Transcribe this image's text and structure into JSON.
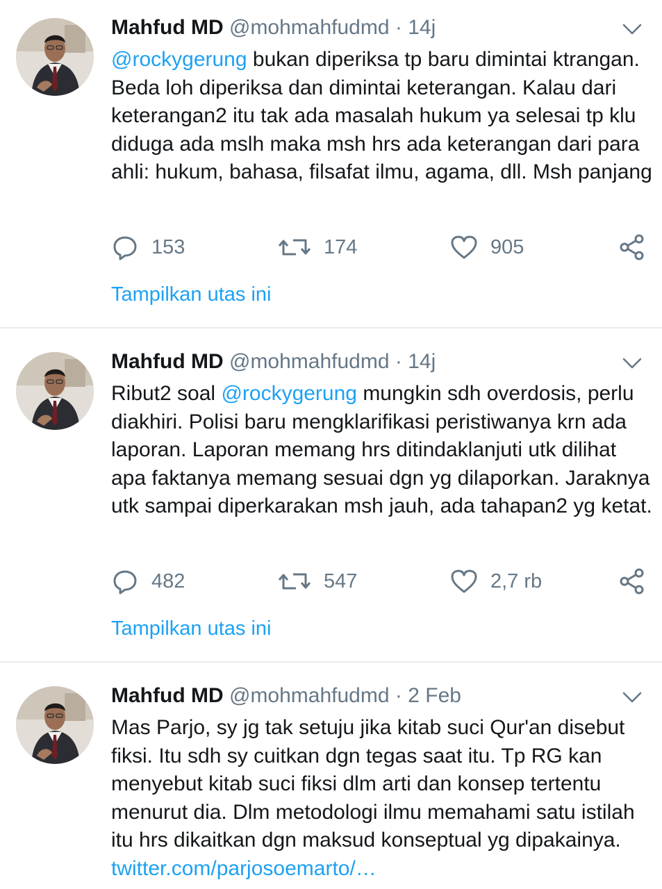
{
  "tweets": [
    {
      "author_name": "Mahfud MD",
      "handle": "@mohmahfudmd",
      "separator": "·",
      "time": "14j",
      "mention": "@rockygerung",
      "text_after_mention": " bukan diperiksa tp baru dimintai ktrangan. Beda loh diperiksa dan dimintai keterangan. Kalau dari keterangan2 itu tak ada masalah hukum ya selesai tp klu diduga ada mslh maka msh hrs ada keterangan dari para ahli: hukum, bahasa, filsafat ilmu, agama, dll. Msh panjang",
      "replies": "153",
      "retweets": "174",
      "likes": "905",
      "thread_link": "Tampilkan utas ini"
    },
    {
      "author_name": "Mahfud MD",
      "handle": "@mohmahfudmd",
      "separator": "·",
      "time": "14j",
      "text_before_mention": "Ribut2 soal ",
      "mention": "@rockygerung",
      "text_after_mention": " mungkin sdh overdosis, perlu diakhiri. Polisi baru mengklarifikasi peristiwanya krn ada laporan. Laporan memang hrs ditindaklanjuti utk dilihat apa faktanya memang sesuai dgn yg dilaporkan. Jaraknya utk sampai diperkarakan msh jauh, ada tahapan2 yg ketat.",
      "replies": "482",
      "retweets": "547",
      "likes": "2,7 rb",
      "thread_link": "Tampilkan utas ini"
    },
    {
      "author_name": "Mahfud MD",
      "handle": "@mohmahfudmd",
      "separator": "·",
      "time": "2 Feb",
      "text": "Mas Parjo, sy jg tak setuju jika kitab suci Qur'an disebut fiksi. Itu sdh sy cuitkan dgn tegas saat itu. Tp RG kan menyebut kitab suci fiksi dlm arti dan konsep tertentu menurut dia. Dlm metodologi ilmu memahami satu istilah itu hrs dikaitkan dgn maksud konseptual yg dipakainya. ",
      "link": "twitter.com/parjosoemarto/…"
    }
  ],
  "icons": {
    "caret": "chevron-down-icon",
    "reply": "reply-bubble-icon",
    "retweet": "retweet-icon",
    "like": "heart-icon",
    "share": "share-icon",
    "avatar": "profile-photo"
  },
  "colors": {
    "accent": "#1da1f2",
    "muted": "#657786",
    "text": "#14171a",
    "divider": "#e6ecf0"
  }
}
